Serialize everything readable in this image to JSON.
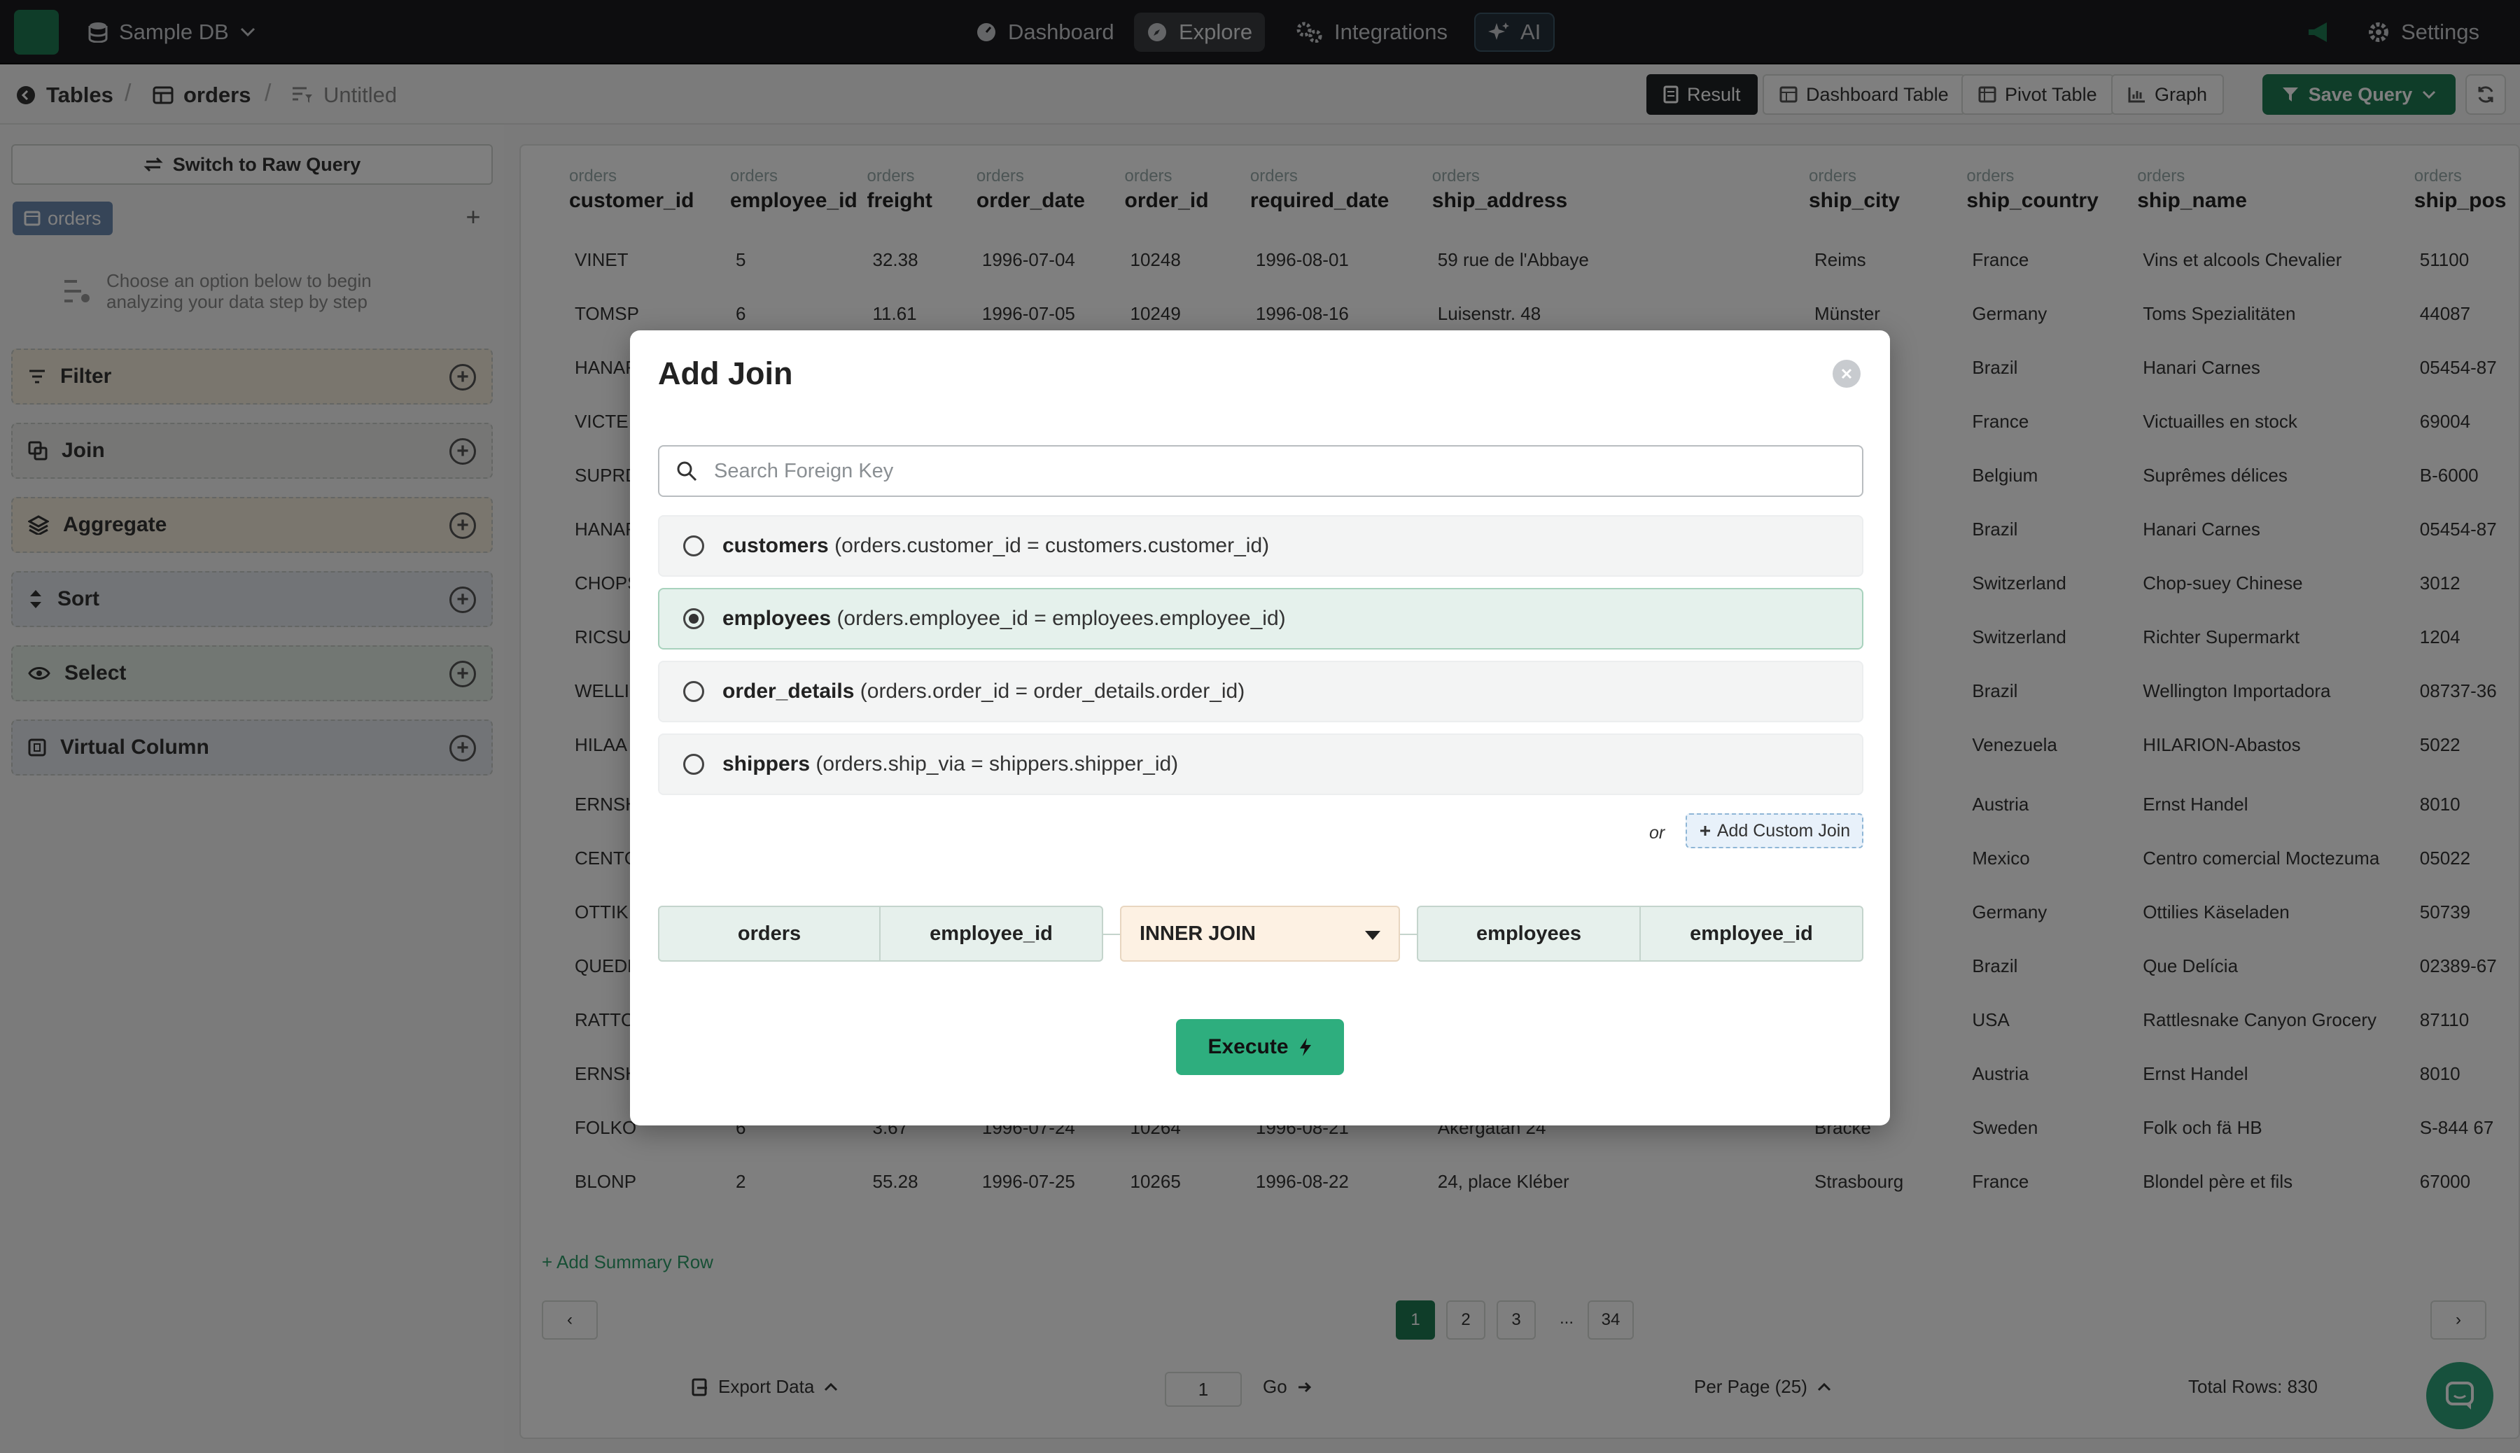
{
  "topbar": {
    "db_label": "Sample DB",
    "nav": [
      {
        "label": "Dashboard"
      },
      {
        "label": "Explore"
      },
      {
        "label": "Integrations"
      },
      {
        "label": "AI"
      }
    ],
    "settings_label": "Settings"
  },
  "breadcrumb": {
    "tables": "Tables",
    "table": "orders",
    "query": "Untitled"
  },
  "views": {
    "result": "Result",
    "dashboard_table": "Dashboard Table",
    "pivot_table": "Pivot Table",
    "graph": "Graph",
    "save_query": "Save Query"
  },
  "sidebar": {
    "raw_query": "Switch to Raw Query",
    "table_tag": "orders",
    "hint": "Choose an option below to begin analyzing your data step by step",
    "steps": [
      {
        "label": "Filter",
        "color": "#f4ecdd"
      },
      {
        "label": "Join",
        "color": "#ececea"
      },
      {
        "label": "Aggregate",
        "color": "#f4ecdd"
      },
      {
        "label": "Sort",
        "color": "#e4e8ef"
      },
      {
        "label": "Select",
        "color": "#e4efe6"
      },
      {
        "label": "Virtual Column",
        "color": "#e4e8ef"
      }
    ]
  },
  "table": {
    "prefix": "orders",
    "columns": [
      "customer_id",
      "employee_id",
      "freight",
      "order_date",
      "order_id",
      "required_date",
      "ship_address",
      "ship_city",
      "ship_country",
      "ship_name",
      "ship_pos"
    ],
    "rows": [
      [
        "VINET",
        "5",
        "32.38",
        "1996-07-04",
        "10248",
        "1996-08-01",
        "59 rue de l'Abbaye",
        "Reims",
        "France",
        "Vins et alcools Chevalier",
        "51100"
      ],
      [
        "TOMSP",
        "6",
        "11.61",
        "1996-07-05",
        "10249",
        "1996-08-16",
        "Luisenstr. 48",
        "Münster",
        "Germany",
        "Toms Spezialitäten",
        "44087"
      ],
      [
        "HANAR",
        "",
        "",
        "",
        "",
        "",
        "",
        "eiro",
        "Brazil",
        "Hanari Carnes",
        "05454-87"
      ],
      [
        "VICTE",
        "",
        "",
        "",
        "",
        "",
        "",
        "",
        "France",
        "Victuailles en stock",
        "69004"
      ],
      [
        "SUPRD",
        "",
        "",
        "",
        "",
        "",
        "",
        "",
        "Belgium",
        "Suprêmes délices",
        "B-6000"
      ],
      [
        "HANAR",
        "",
        "",
        "",
        "",
        "",
        "",
        "eiro",
        "Brazil",
        "Hanari Carnes",
        "05454-87"
      ],
      [
        "CHOPS",
        "",
        "",
        "",
        "",
        "",
        "",
        "",
        "Switzerland",
        "Chop-suey Chinese",
        "3012"
      ],
      [
        "RICSU",
        "",
        "",
        "",
        "",
        "",
        "",
        "",
        "Switzerland",
        "Richter Supermarkt",
        "1204"
      ],
      [
        "WELLI",
        "",
        "",
        "",
        "",
        "",
        "",
        "",
        "Brazil",
        "Wellington Importadora",
        "08737-36"
      ],
      [
        "HILAA",
        "",
        "",
        "",
        "",
        "",
        "",
        "bal",
        "Venezuela",
        "HILARION-Abastos",
        "5022"
      ],
      [
        "ERNSH",
        "",
        "",
        "",
        "",
        "",
        "",
        "",
        "Austria",
        "Ernst Handel",
        "8010"
      ],
      [
        "CENTC",
        "",
        "",
        "",
        "",
        "",
        "",
        "F.",
        "Mexico",
        "Centro comercial Moctezuma",
        "05022"
      ],
      [
        "OTTIK",
        "",
        "",
        "",
        "",
        "",
        "",
        "",
        "Germany",
        "Ottilies Käseladen",
        "50739"
      ],
      [
        "QUEDE",
        "",
        "",
        "",
        "",
        "",
        "",
        "eiro",
        "Brazil",
        "Que Delícia",
        "02389-67"
      ],
      [
        "RATTC",
        "",
        "",
        "",
        "",
        "",
        "",
        "que",
        "USA",
        "Rattlesnake Canyon Grocery",
        "87110"
      ],
      [
        "ERNSH",
        "",
        "",
        "",
        "",
        "",
        "",
        "",
        "Austria",
        "Ernst Handel",
        "8010"
      ],
      [
        "FOLKO",
        "6",
        "3.67",
        "1996-07-24",
        "10264",
        "1996-08-21",
        "Åkergatan 24",
        "Bräcke",
        "Sweden",
        "Folk och fä HB",
        "S-844 67"
      ],
      [
        "BLONP",
        "2",
        "55.28",
        "1996-07-25",
        "10265",
        "1996-08-22",
        "24, place Kléber",
        "Strasbourg",
        "France",
        "Blondel père et fils",
        "67000"
      ]
    ],
    "add_summary": "+ Add Summary Row",
    "pages": [
      "1",
      "2",
      "3",
      "...",
      "34"
    ],
    "export": "Export Data",
    "page_input": "1",
    "go": "Go",
    "per_page": "Per Page (25)",
    "total_rows": "Total Rows: 830"
  },
  "modal": {
    "title": "Add Join",
    "search_placeholder": "Search Foreign Key",
    "options": [
      {
        "table": "customers",
        "condition": "(orders.customer_id = customers.customer_id)",
        "selected": false
      },
      {
        "table": "employees",
        "condition": "(orders.employee_id = employees.employee_id)",
        "selected": true
      },
      {
        "table": "order_details",
        "condition": "(orders.order_id = order_details.order_id)",
        "selected": false
      },
      {
        "table": "shippers",
        "condition": "(orders.ship_via = shippers.shipper_id)",
        "selected": false
      }
    ],
    "or_label": "or",
    "add_custom_join": "Add Custom Join",
    "join": {
      "left_table": "orders",
      "left_column": "employee_id",
      "type": "INNER JOIN",
      "right_table": "employees",
      "right_column": "employee_id"
    },
    "execute": "Execute"
  },
  "colors": {
    "brand": "#1e7a52",
    "execute": "#2eae7e",
    "selected_option": "#e5f1ec"
  }
}
